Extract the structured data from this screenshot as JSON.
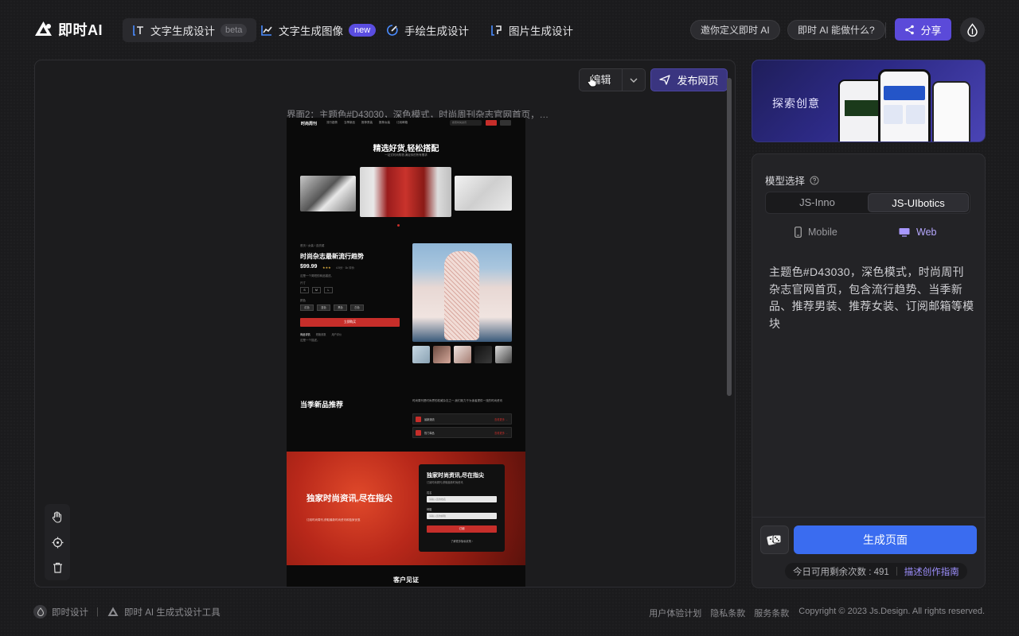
{
  "header": {
    "logo_text": "即时AI",
    "tabs": [
      {
        "label": "文字生成设计",
        "badge": "beta",
        "icon": "text-design-icon"
      },
      {
        "label": "文字生成图像",
        "badge": "new",
        "icon": "chart-image-icon"
      },
      {
        "label": "手绘生成设计",
        "icon": "sketch-icon"
      },
      {
        "label": "图片生成设计",
        "icon": "image-design-icon"
      }
    ],
    "invite_label": "邀你定义即时 AI",
    "what_can_label": "即时 AI 能做什么?",
    "share_label": "分享",
    "brand_color": "#5b4ad9"
  },
  "canvas": {
    "edit_label": "编辑",
    "publish_label": "发布网页",
    "frame_caption": "界面2：主题色#D43030，深色模式，时尚周刊杂志官网首页，…"
  },
  "preview": {
    "brand": "时尚周刊",
    "nav_links": [
      "流行趋势",
      "当季新品",
      "推荐男装",
      "推荐女装",
      "订阅邮箱"
    ],
    "search_placeholder": "搜索时尚资讯",
    "hero_title": "精选好货,轻松搭配",
    "hero_sub": "一站式时尚购物,满足你的所有需求",
    "breadcrumb": "首页 / 女装 / 连衣裙",
    "product_title": "时尚杂志最新流行趋势",
    "price": "$99.99",
    "stars": "★★★",
    "rating_text": "4.5分 · 1k 评价",
    "desc": "这是一个简短的商品描述。",
    "size_label": "尺寸",
    "sizes": [
      "S",
      "M",
      "L"
    ],
    "color_label": "颜色",
    "colors": [
      "红色",
      "蓝色",
      "黑色",
      "白色"
    ],
    "buy_label": "立即购买",
    "tabs": [
      "商品详情",
      "规格参数",
      "用户评价"
    ],
    "tab_text": "这是一个描述。",
    "section_title": "当季新品推荐",
    "section_text": "时尚周刊是时尚界的权威杂志之一,我们致力于为读者提供一流的时尚资讯",
    "rows": [
      {
        "title": "最新潮流",
        "action": "查看更多 →"
      },
      {
        "title": "热门单品",
        "action": "查看更多 →"
      }
    ],
    "banner_title": "独家时尚资讯,尽在指尖",
    "banner_sub": "订阅时尚周刊,获取最新时尚资讯和独家优惠",
    "form_title": "独家时尚资讯,尽在指尖",
    "form_sub": "订阅时尚周刊,获取最新时尚资讯",
    "form_name_label": "姓名",
    "form_name_ph": "请输入您的姓名",
    "form_email_label": "邮箱",
    "form_email_ph": "请输入您的邮箱",
    "form_btn": "订阅",
    "form_link": "了解更多隐私政策 ›",
    "testimonial_title": "客户见证",
    "accent": "#D43030"
  },
  "sidebar": {
    "explore_label": "探索创意",
    "model_label": "模型选择",
    "models": [
      "JS-Inno",
      "JS-UIbotics"
    ],
    "devices": [
      "Mobile",
      "Web"
    ],
    "prompt": "主题色#D43030，深色模式，时尚周刊杂志官网首页，包含流行趋势、当季新品、推荐男装、推荐女装、订阅邮箱等模块",
    "generate_label": "生成页面",
    "quota_label": "今日可用剩余次数 : 491",
    "guide_label": "描述创作指南"
  },
  "footer": {
    "brand": "即时设计",
    "tool": "即时 AI 生成式设计工具",
    "links": [
      "用户体验计划",
      "隐私条款",
      "服务条款"
    ],
    "copyright": "Copyright © 2023 Js.Design. All rights reserved."
  }
}
